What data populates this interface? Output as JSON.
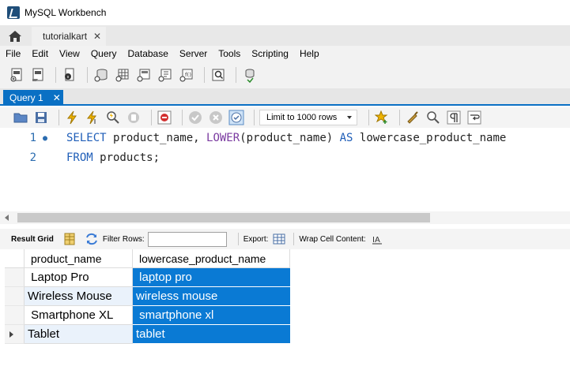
{
  "window": {
    "title": "MySQL Workbench"
  },
  "tabs": {
    "connection_tab": "tutorialkart",
    "close_glyph": "✕"
  },
  "menu": [
    "File",
    "Edit",
    "View",
    "Query",
    "Database",
    "Server",
    "Tools",
    "Scripting",
    "Help"
  ],
  "query_tab": {
    "label": "Query 1",
    "close_glyph": "✕"
  },
  "sql_toolbar": {
    "limit_value": "Limit to 1000 rows"
  },
  "editor": {
    "lines": [
      {
        "number": "1",
        "marker": "●"
      },
      {
        "number": "2",
        "marker": ""
      }
    ],
    "line1": {
      "kw1": "SELECT",
      "id1": " product_name, ",
      "fn1": "LOWER",
      "id2": "(product_name) ",
      "kw2": "AS",
      "id3": " lowercase_product_name"
    },
    "line2": {
      "kw1": "FROM",
      "id1": " products;"
    }
  },
  "result_toolbar": {
    "result_grid_label": "Result Grid",
    "filter_label": "Filter Rows:",
    "filter_value": "",
    "export_label": "Export:",
    "wrap_label": "Wrap Cell Content:"
  },
  "grid": {
    "columns": [
      "product_name",
      "lowercase_product_name"
    ],
    "rows": [
      {
        "product_name": " Laptop Pro",
        "lowercase_product_name": " laptop pro"
      },
      {
        "product_name": "Wireless Mouse",
        "lowercase_product_name": "wireless mouse"
      },
      {
        "product_name": " Smartphone XL",
        "lowercase_product_name": " smartphone xl"
      },
      {
        "product_name": "Tablet",
        "lowercase_product_name": "tablet"
      }
    ]
  },
  "colors": {
    "accent": "#0a70c4",
    "selection": "#0a7ad4",
    "keyword": "#1f5eb8"
  }
}
